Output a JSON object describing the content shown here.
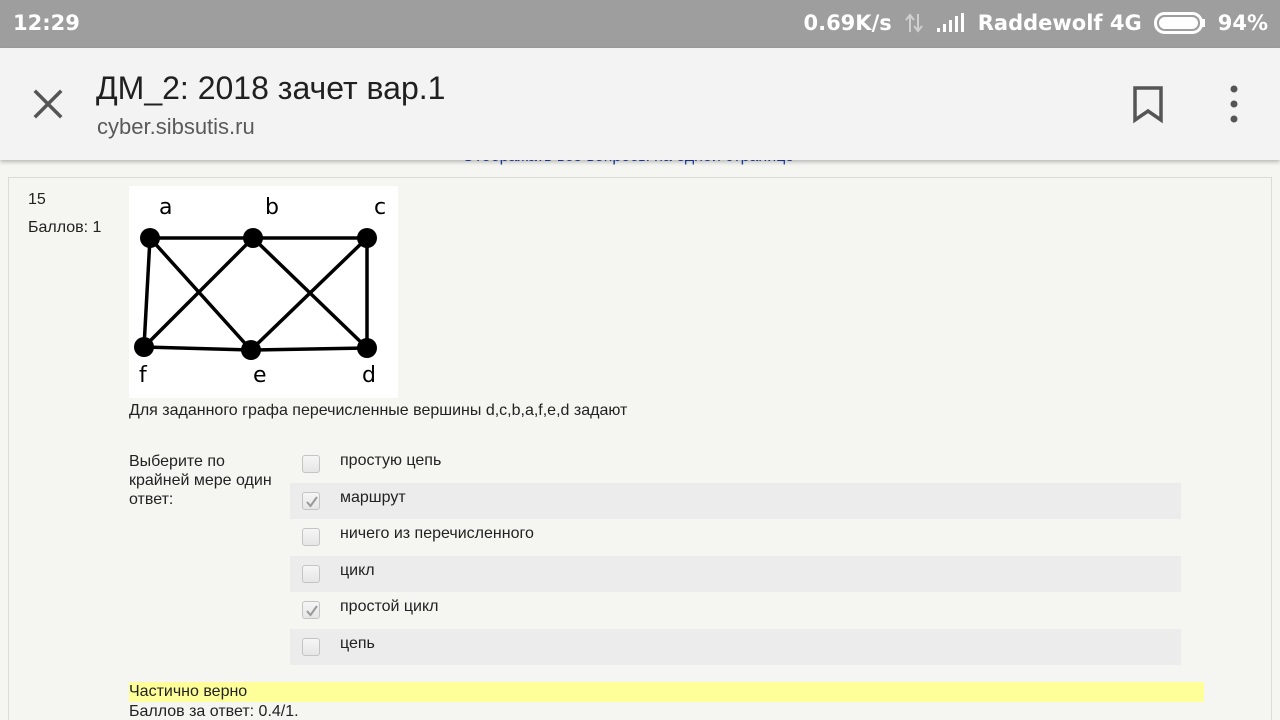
{
  "status_bar": {
    "time": "12:29",
    "speed": "0.69K/s",
    "carrier": "Raddewolf 4G",
    "battery": "94%"
  },
  "toolbar": {
    "title": "ДМ_2: 2018 зачет вар.1",
    "url": "cyber.sibsutis.ru"
  },
  "hidden_link": "Отображать все вопросы на одной странице",
  "question": {
    "number": "15",
    "points": "Баллов: 1",
    "text": "Для заданного графа перечисленные вершины d,c,b,a,f,e,d задают",
    "prompt": "Выберите по крайней мере один ответ:",
    "graph": {
      "vertices": [
        "a",
        "b",
        "c",
        "d",
        "e",
        "f"
      ],
      "edges": [
        [
          "a",
          "b"
        ],
        [
          "b",
          "c"
        ],
        [
          "c",
          "d"
        ],
        [
          "d",
          "e"
        ],
        [
          "e",
          "f"
        ],
        [
          "f",
          "a"
        ],
        [
          "a",
          "e"
        ],
        [
          "b",
          "f"
        ],
        [
          "b",
          "d"
        ],
        [
          "c",
          "e"
        ]
      ]
    },
    "answers": [
      {
        "label": "простую цепь",
        "checked": false
      },
      {
        "label": "маршрут",
        "checked": true
      },
      {
        "label": "ничего из перечисленного",
        "checked": false
      },
      {
        "label": "цикл",
        "checked": false
      },
      {
        "label": "простой цикл",
        "checked": true
      },
      {
        "label": "цепь",
        "checked": false
      }
    ],
    "feedback": "Частично верно",
    "score": "Баллов за ответ: 0.4/1."
  }
}
